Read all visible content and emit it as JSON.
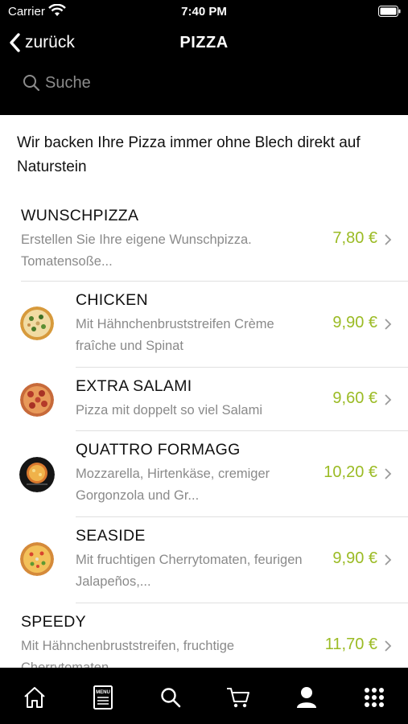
{
  "status_bar": {
    "carrier": "Carrier",
    "time": "7:40 PM"
  },
  "header": {
    "back_label": "zurück",
    "title": "PIZZA"
  },
  "search": {
    "placeholder": "Suche"
  },
  "intro": "Wir backen Ihre Pizza immer ohne Blech direkt auf Naturstein",
  "items": [
    {
      "title": "WUNSCHPIZZA",
      "desc": "Erstellen Sie Ihre eigene Wunschpizza. Tomatensoße...",
      "price": "7,80 €"
    },
    {
      "title": "CHICKEN",
      "desc": "Mit Hähnchenbruststreifen Crème fraîche und Spinat",
      "price": "9,90 €"
    },
    {
      "title": "EXTRA SALAMI",
      "desc": "Pizza mit doppelt so viel Salami",
      "price": "9,60 €"
    },
    {
      "title": "QUATTRO FORMAGG",
      "desc": "Mozzarella, Hirtenkäse, cremiger Gorgonzola und Gr...",
      "price": "10,20 €"
    },
    {
      "title": "SEASIDE",
      "desc": "Mit fruchtigen Cherrytomaten, feurigen Jalapeños,...",
      "price": "9,90 €"
    },
    {
      "title": "SPEEDY",
      "desc": "Mit Hähnchenbruststreifen, fruchtige Cherrytomaten",
      "price": "11,70 €"
    }
  ],
  "tabbar": {
    "icons": [
      "home-icon",
      "menu-card-icon",
      "search-icon",
      "cart-icon",
      "user-icon",
      "grid-icon"
    ],
    "menu_glyph_text": "MENU"
  },
  "colors": {
    "accent_price": "#9bbb24",
    "header_bg": "#000000",
    "description": "#8a8a8a"
  }
}
